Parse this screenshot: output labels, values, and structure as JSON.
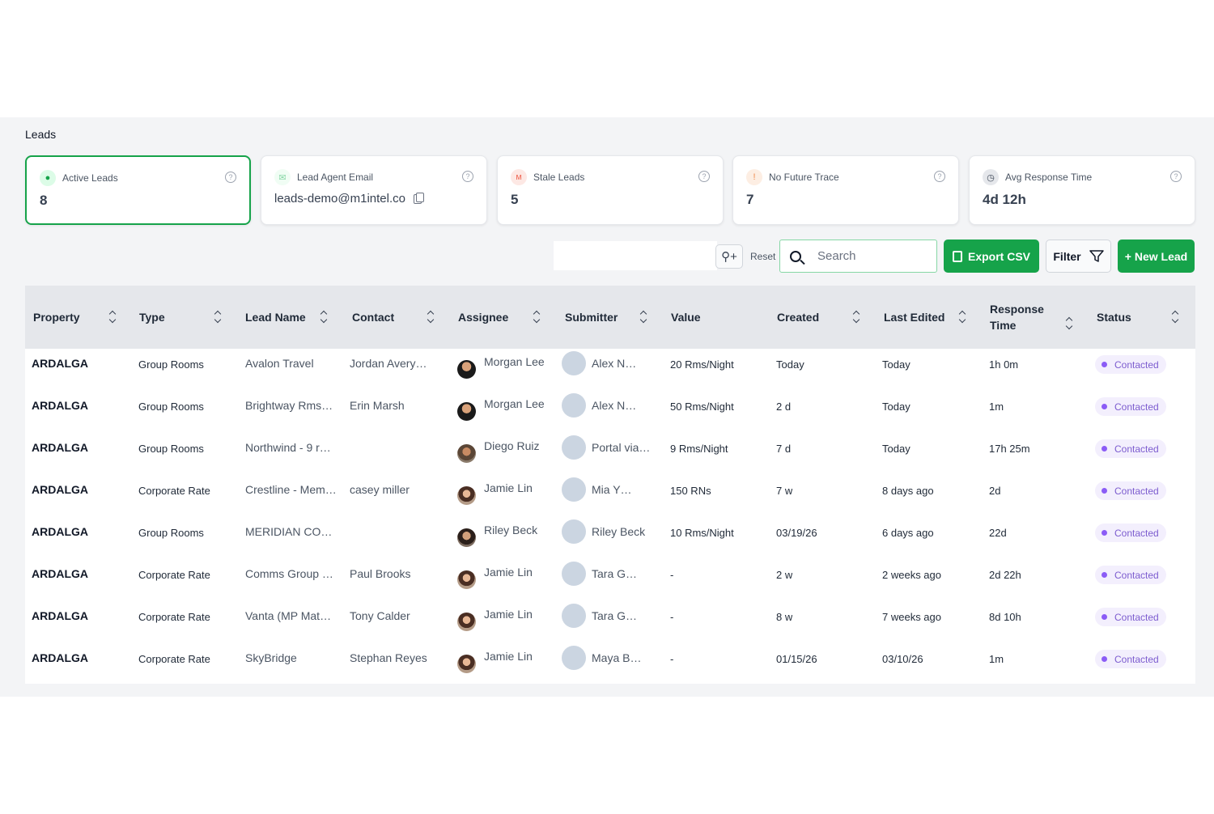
{
  "page": {
    "title": "Leads"
  },
  "cards": [
    {
      "label": "Active Leads",
      "value": "8",
      "icon": "pin-icon"
    },
    {
      "label": "Lead Agent Email",
      "value": "leads-demo@m1intel.co",
      "icon": "mail-icon"
    },
    {
      "label": "Stale Leads",
      "value": "5",
      "icon": "stale-icon"
    },
    {
      "label": "No Future Trace",
      "value": "7",
      "icon": "alert-icon"
    },
    {
      "label": "Avg Response Time",
      "value": "4d 12h",
      "icon": "clock-icon"
    }
  ],
  "toolbar": {
    "reset_label": "Reset",
    "search_placeholder": "Search",
    "export_label": "Export CSV",
    "filter_label": "Filter",
    "new_lead_label": "+ New Lead"
  },
  "table": {
    "headers": [
      "Property",
      "Type",
      "Lead Name",
      "Contact",
      "Assignee",
      "Submitter",
      "Value",
      "Created",
      "Last Edited",
      "Response",
      "Time",
      "Status"
    ],
    "rows": [
      {
        "property": "ARDALGA",
        "type": "Group Rooms",
        "lead_name": "Avalon Travel",
        "contact": "Jordan Avery…",
        "assignee": "Morgan Lee",
        "submitter": "Alex N…",
        "value": "20 Rms/Night",
        "created": "Today",
        "last_edited": "Today",
        "response": "1h 0m",
        "status": "Contacted"
      },
      {
        "property": "ARDALGA",
        "type": "Group Rooms",
        "lead_name": "Brightway Rms…",
        "contact": "Erin Marsh",
        "assignee": "Morgan Lee",
        "submitter": "Alex N…",
        "value": "50 Rms/Night",
        "created": "2 d",
        "last_edited": "Today",
        "response": "1m",
        "status": "Contacted"
      },
      {
        "property": "ARDALGA",
        "type": "Group Rooms",
        "lead_name": "Northwind - 9 r…",
        "contact": "",
        "assignee": "Diego Ruiz",
        "submitter": "Portal via…",
        "value": "9 Rms/Night",
        "created": "7 d",
        "last_edited": "Today",
        "response": "17h 25m",
        "status": "Contacted"
      },
      {
        "property": "ARDALGA",
        "type": "Corporate Rate",
        "lead_name": "Crestline - Mem…",
        "contact": "casey miller",
        "assignee": "Jamie Lin",
        "submitter": "Mia Y…",
        "value": "150 RNs",
        "created": "7 w",
        "last_edited": "8 days ago",
        "response": "2d",
        "status": "Contacted"
      },
      {
        "property": "ARDALGA",
        "type": "Group Rooms",
        "lead_name": "MERIDIAN CO…",
        "contact": "",
        "assignee": "Riley Beck",
        "submitter": "Riley Beck",
        "value": "10 Rms/Night",
        "created": "03/19/26",
        "last_edited": "6 days ago",
        "response": "22d",
        "status": "Contacted"
      },
      {
        "property": "ARDALGA",
        "type": "Corporate Rate",
        "lead_name": "Comms Group …",
        "contact": "Paul Brooks",
        "assignee": "Jamie Lin",
        "submitter": "Tara G…",
        "value": "-",
        "created": "2 w",
        "last_edited": "2 weeks ago",
        "response": "2d 22h",
        "status": "Contacted"
      },
      {
        "property": "ARDALGA",
        "type": "Corporate Rate",
        "lead_name": "Vanta (MP Mat…",
        "contact": "Tony Calder",
        "assignee": "Jamie Lin",
        "submitter": "Tara G…",
        "value": "-",
        "created": "8 w",
        "last_edited": "7 weeks ago",
        "response": "8d 10h",
        "status": "Contacted"
      },
      {
        "property": "ARDALGA",
        "type": "Corporate Rate",
        "lead_name": "SkyBridge",
        "contact": "Stephan Reyes",
        "assignee": "Jamie Lin",
        "submitter": "Maya B…",
        "value": "-",
        "created": "01/15/26",
        "last_edited": "03/10/26",
        "response": "1m",
        "status": "Contacted"
      }
    ]
  },
  "colors": {
    "accent": "#16a34a",
    "badge_bg": "#f3effd",
    "badge_text": "#7c5ccf",
    "header_bg": "#e5e7eb"
  }
}
